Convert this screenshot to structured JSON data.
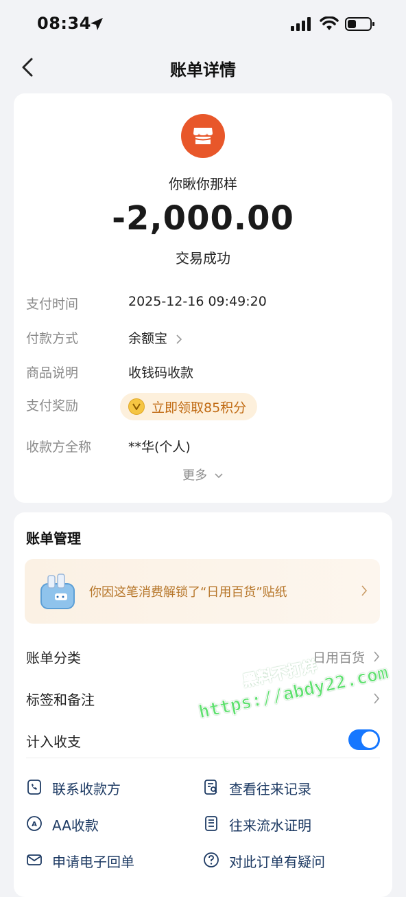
{
  "status_bar": {
    "time": "08:34"
  },
  "nav": {
    "title": "账单详情"
  },
  "summary": {
    "merchant_name": "你瞅你那样",
    "amount": "-2,000.00",
    "status": "交易成功",
    "details": [
      {
        "label": "支付时间",
        "value": "2025-12-16 09:49:20"
      },
      {
        "label": "付款方式",
        "value": "余额宝"
      },
      {
        "label": "商品说明",
        "value": "收钱码收款"
      },
      {
        "label": "支付奖励",
        "value": "立即领取85积分"
      },
      {
        "label": "收款方全称",
        "value": "**华(个人)"
      }
    ],
    "more": "更多"
  },
  "manage": {
    "title": "账单管理",
    "sticker_text": "你因这笔消费解锁了“日用百货”贴纸",
    "category_label": "账单分类",
    "category_value": "日用百货",
    "tags_label": "标签和备注",
    "tags_value": "",
    "income_label": "计入收支",
    "income_toggle_on": true,
    "actions": [
      {
        "label": "联系收款方",
        "icon": "phone-icon"
      },
      {
        "label": "查看往来记录",
        "icon": "record-search-icon"
      },
      {
        "label": "AA收款",
        "icon": "aa-icon"
      },
      {
        "label": "往来流水证明",
        "icon": "document-icon"
      },
      {
        "label": "申请电子回单",
        "icon": "mail-icon"
      },
      {
        "label": "对此订单有疑问",
        "icon": "question-icon"
      }
    ]
  },
  "watermark": {
    "line1": "黑料不打烊",
    "line2": "https://abdy22.com"
  },
  "colors": {
    "accent": "#1677ff",
    "merchant_icon": "#e8572a",
    "reward_text": "#c06a12"
  }
}
